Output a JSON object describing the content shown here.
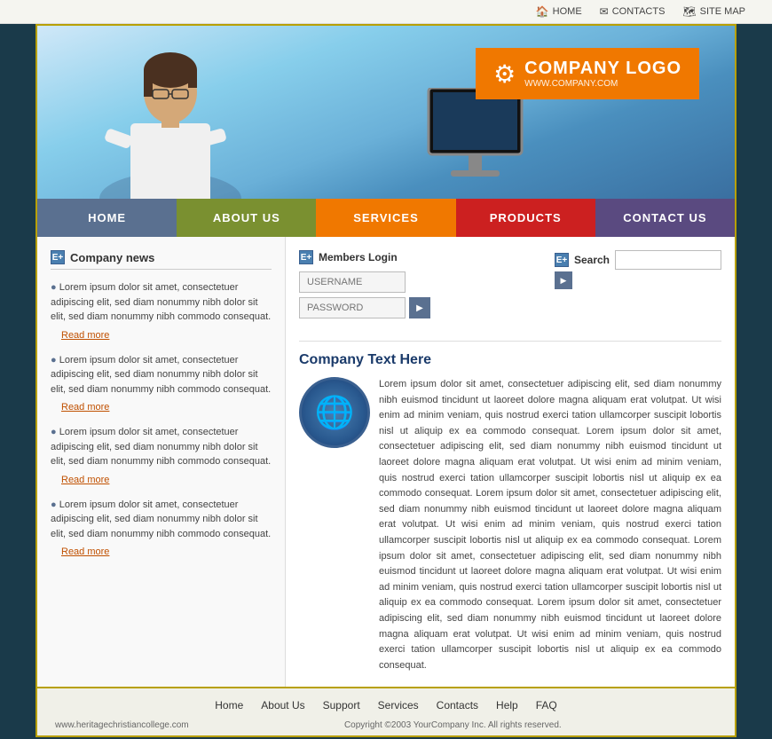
{
  "topBar": {
    "home": "HOME",
    "contacts": "CONTACTS",
    "sitemap": "SITE MAP"
  },
  "logo": {
    "companyName": "COMPANY LOGO",
    "url": "WWW.COMPANY.COM"
  },
  "nav": {
    "items": [
      {
        "id": "home",
        "label": "HOME"
      },
      {
        "id": "about",
        "label": "ABOUT US"
      },
      {
        "id": "services",
        "label": "SERVICES"
      },
      {
        "id": "products",
        "label": "PRODUCTS"
      },
      {
        "id": "contact",
        "label": "CONTACT US"
      }
    ]
  },
  "sidebar": {
    "title": "Company news",
    "items": [
      {
        "text": "Lorem ipsum dolor sit amet, consectetuer adipiscing elit, sed diam nonummy nibh dolor sit elit, sed diam nonummy nibh commodo consequat.",
        "readMore": "Read more"
      },
      {
        "text": "Lorem ipsum dolor sit amet, consectetuer adipiscing elit, sed diam nonummy nibh dolor sit elit, sed diam nonummy nibh commodo consequat.",
        "readMore": "Read more"
      },
      {
        "text": "Lorem ipsum dolor sit amet, consectetuer adipiscing elit, sed diam nonummy nibh dolor sit elit, sed diam nonummy nibh commodo consequat.",
        "readMore": "Read more"
      },
      {
        "text": "Lorem ipsum dolor sit amet, consectetuer adipiscing elit, sed diam nonummy nibh dolor sit elit, sed diam nonummy nibh commodo consequat.",
        "readMore": "Read more"
      }
    ]
  },
  "membersLogin": {
    "title": "Members Login",
    "usernamePlaceholder": "USERNAME",
    "passwordPlaceholder": "PASSWORD"
  },
  "search": {
    "title": "Search"
  },
  "company": {
    "title": "Company Text Here",
    "icon": "🌐",
    "body": "Lorem ipsum dolor sit amet, consectetuer adipiscing elit, sed diam nonummy nibh euismod tincidunt ut laoreet dolore magna aliquam erat volutpat. Ut wisi enim ad minim veniam, quis nostrud exerci tation ullamcorper suscipit lobortis nisl ut aliquip ex ea commodo consequat. Lorem ipsum dolor sit amet, consectetuer adipiscing elit, sed diam nonummy nibh euismod tincidunt ut laoreet dolore magna aliquam erat volutpat. Ut wisi enim ad minim veniam, quis nostrud exerci tation ullamcorper suscipit lobortis nisl ut aliquip ex ea commodo consequat. Lorem ipsum dolor sit amet, consectetuer adipiscing elit, sed diam nonummy nibh euismod tincidunt ut laoreet dolore magna aliquam erat volutpat. Ut wisi enim ad minim veniam, quis nostrud exerci tation ullamcorper suscipit lobortis nisl ut aliquip ex ea commodo consequat. Lorem ipsum dolor sit amet, consectetuer adipiscing elit, sed diam nonummy nibh euismod tincidunt ut laoreet dolore magna aliquam erat volutpat. Ut wisi enim ad minim veniam, quis nostrud exerci tation ullamcorper suscipit lobortis nisl ut aliquip ex ea commodo consequat. Lorem ipsum dolor sit amet, consectetuer adipiscing elit, sed diam nonummy nibh euismod tincidunt ut laoreet dolore magna aliquam erat volutpat. Ut wisi enim ad minim veniam, quis nostrud exerci tation ullamcorper suscipit lobortis nisl ut aliquip ex ea commodo consequat."
  },
  "footer": {
    "links": [
      {
        "label": "Home"
      },
      {
        "label": "About Us"
      },
      {
        "label": "Support"
      },
      {
        "label": "Services"
      },
      {
        "label": "Contacts"
      },
      {
        "label": "Help"
      },
      {
        "label": "FAQ"
      }
    ],
    "siteUrl": "www.heritagechristiancollege.com",
    "copyright": "Copyright ©2003 YourCompany Inc. All rights reserved."
  }
}
